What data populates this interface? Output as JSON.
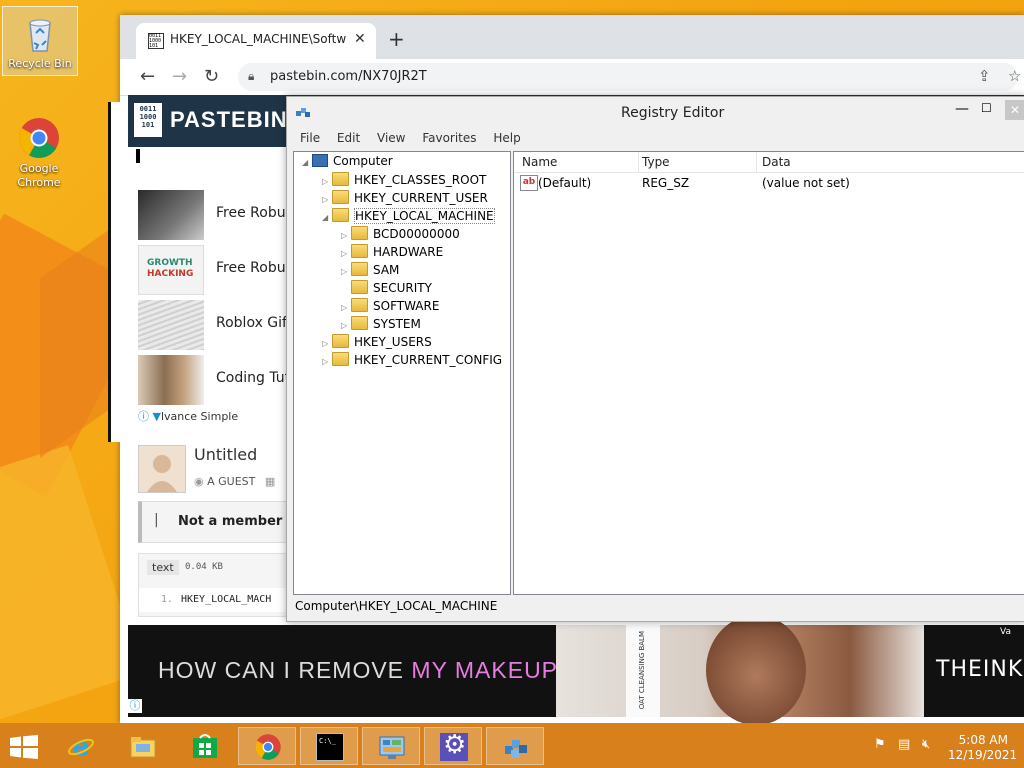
{
  "desktop": {
    "icons": [
      {
        "label": "Recycle Bin"
      },
      {
        "label": "Google Chrome"
      }
    ]
  },
  "browser": {
    "tab_title": "HKEY_LOCAL_MACHINE\\Software",
    "url": "pastebin.com/NX70JR2T",
    "page": {
      "logo_digits": "0011 1000 101",
      "site_name": "PASTEBIN",
      "ad_list": [
        {
          "title": "Free Robux"
        },
        {
          "title": "Free Robux"
        },
        {
          "title": "Roblox Gift"
        },
        {
          "title": "Coding Tut"
        }
      ],
      "ad_footer": "lvance Simple",
      "paste_title": "Untitled",
      "author": "A GUEST",
      "member_text": "Not a member o",
      "syntax": "text",
      "size": "0.04 KB",
      "line_number": "1.",
      "line_text": "HKEY_LOCAL_MACH",
      "banner": {
        "text_part1": "HOW CAN I REMOVE ",
        "text_part2": "MY MAKEUP",
        "text_part3": "?",
        "photo_text": "OAT CLEANSING BALM",
        "brand": "THEINKE",
        "corner_label": "Va",
        "text_color_accent": "#e67de0"
      }
    }
  },
  "regedit": {
    "title": "Registry Editor",
    "menu": [
      "File",
      "Edit",
      "View",
      "Favorites",
      "Help"
    ],
    "tree": {
      "root": "Computer",
      "hives": [
        {
          "label": "HKEY_CLASSES_ROOT"
        },
        {
          "label": "HKEY_CURRENT_USER"
        },
        {
          "label": "HKEY_LOCAL_MACHINE"
        },
        {
          "label": "HKEY_USERS"
        },
        {
          "label": "HKEY_CURRENT_CONFIG"
        }
      ],
      "hklm_children": [
        {
          "label": "BCD00000000"
        },
        {
          "label": "HARDWARE"
        },
        {
          "label": "SAM"
        },
        {
          "label": "SECURITY"
        },
        {
          "label": "SOFTWARE"
        },
        {
          "label": "SYSTEM"
        }
      ]
    },
    "columns": [
      "Name",
      "Type",
      "Data"
    ],
    "values": [
      {
        "icon": "ab",
        "name": "(Default)",
        "type": "REG_SZ",
        "data": "(value not set)"
      }
    ],
    "status": "Computer\\HKEY_LOCAL_MACHINE"
  },
  "taskbar": {
    "cmd_glyph": "C:\\_",
    "time": "5:08 AM",
    "date": "12/19/2021",
    "color": "#d7801c"
  }
}
